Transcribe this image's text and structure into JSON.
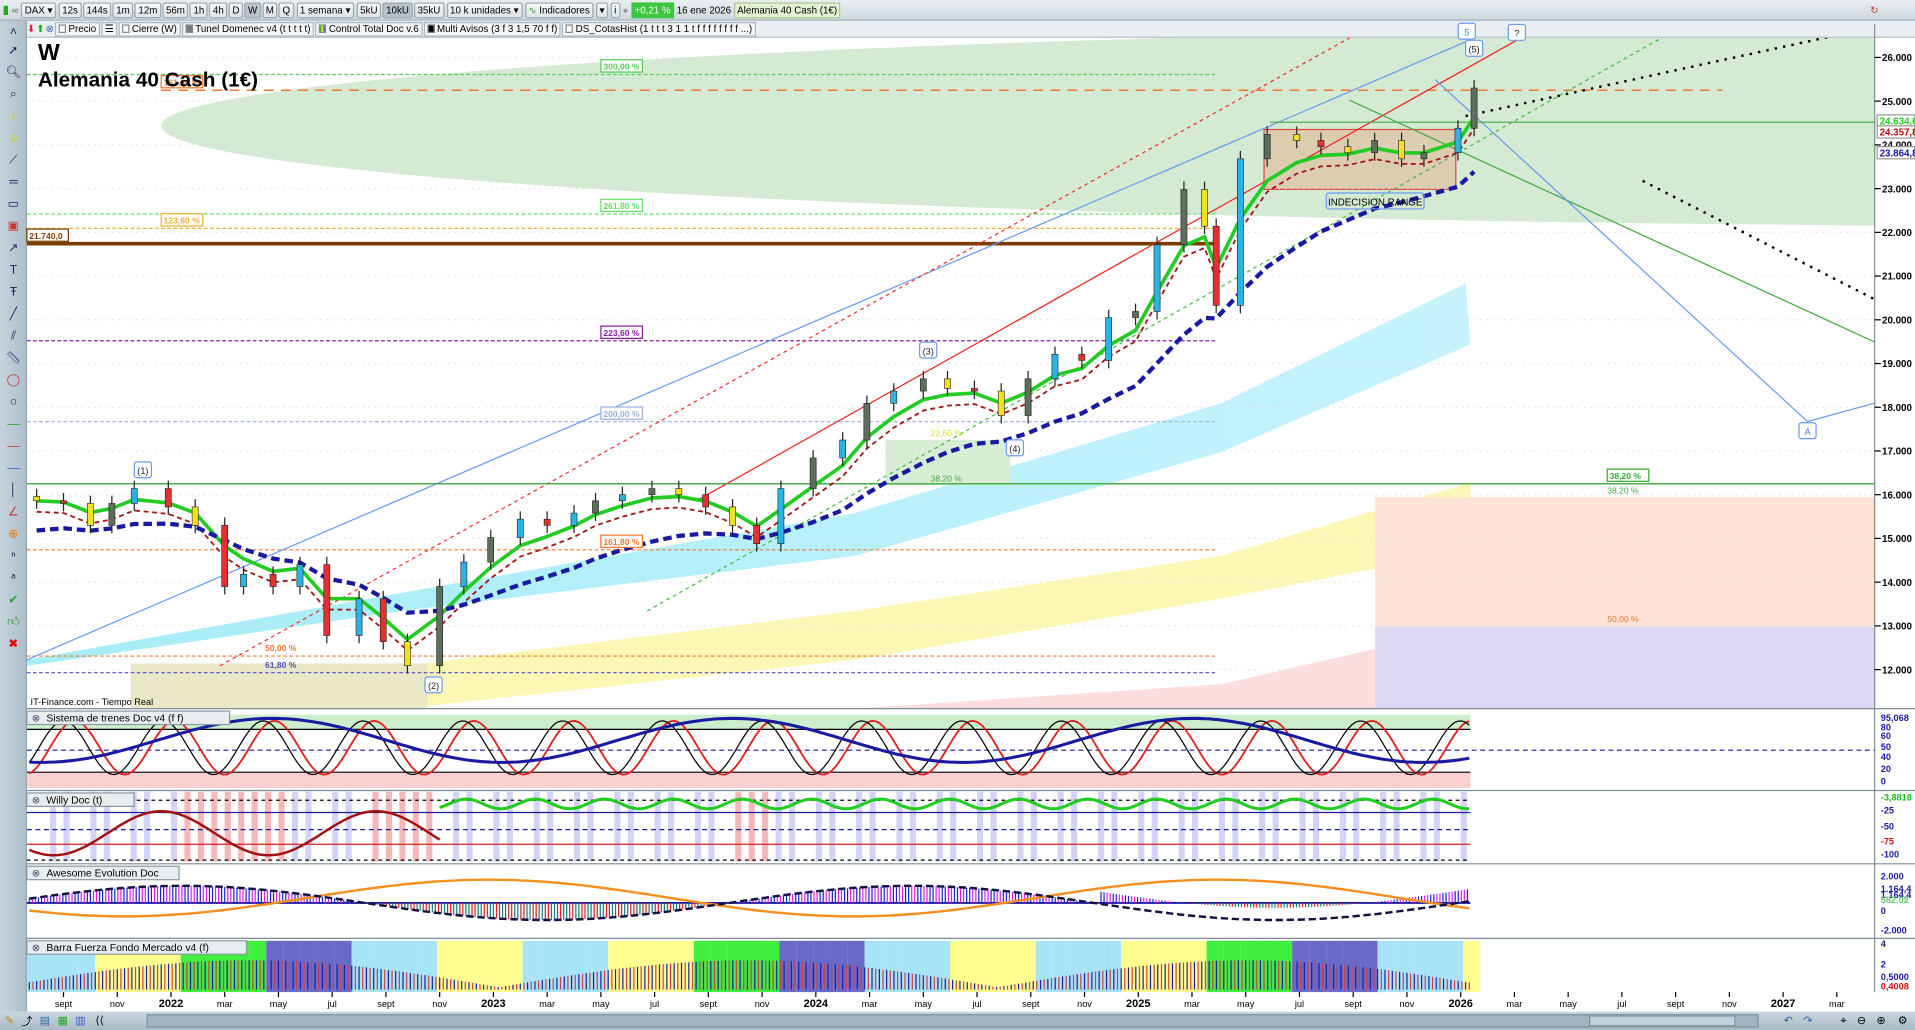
{
  "toolbar": {
    "symbol": "DAX",
    "intervals": [
      "12s",
      "144s",
      "1m",
      "12m",
      "56m",
      "1h",
      "4h",
      "D",
      "W",
      "M",
      "Q"
    ],
    "active_interval": "W",
    "period": "1 semana",
    "units": [
      "5kU",
      "10kU",
      "35kU"
    ],
    "active_unit": "10kU",
    "units_select": "10 k unidades",
    "indicators": "Indicadores",
    "info": "i",
    "change": "+0,21 %",
    "date": "16 ene 2026",
    "instrument": "Alemania 40 Cash (1€)"
  },
  "chips": [
    "Precio",
    "Cierre (W)",
    "Tunel Domenec v4 (t t t t t)",
    "Control Total Doc v.6",
    "Multi Avisos (3 f 3 1,5 70 f f)",
    "DS_CotasHist (1 t t t 3 1 1 t f f f f f f f f ...)"
  ],
  "main": {
    "timeframe": "W",
    "title": "Alemania 40 Cash (1€)",
    "source": "IT-Finance.com - Tiempo Real",
    "range_label": "INDECISION RANGE",
    "waves": [
      "(1)",
      "(2)",
      "(3)",
      "(4)",
      "(5)",
      "5",
      "?",
      "A"
    ],
    "price_badges": [
      {
        "text": "24.634,6",
        "color": "#22cc22"
      },
      {
        "text": "24.357,8",
        "color": "#b01010"
      },
      {
        "text": "23.864,8",
        "color": "#1a1aa0"
      }
    ]
  },
  "chart_data": {
    "type": "candlestick",
    "y_ticks": [
      "26.000",
      "25.000",
      "24.000",
      "23.000",
      "22.000",
      "21.000",
      "20.000",
      "19.000",
      "18.000",
      "17.000",
      "16.000",
      "15.000",
      "14.000",
      "13.000",
      "12.000"
    ],
    "x_ticks": [
      [
        "2021-09",
        "sept"
      ],
      [
        "2021-11",
        "nov"
      ],
      [
        "2022-01",
        "2022"
      ],
      [
        "2022-03",
        "mar"
      ],
      [
        "2022-05",
        "may"
      ],
      [
        "2022-07",
        "jul"
      ],
      [
        "2022-09",
        "sept"
      ],
      [
        "2022-11",
        "nov"
      ],
      [
        "2023-01",
        "2023"
      ],
      [
        "2023-03",
        "mar"
      ],
      [
        "2023-05",
        "may"
      ],
      [
        "2023-07",
        "jul"
      ],
      [
        "2023-09",
        "sept"
      ],
      [
        "2023-11",
        "nov"
      ],
      [
        "2024-01",
        "2024"
      ],
      [
        "2024-03",
        "mar"
      ],
      [
        "2024-05",
        "may"
      ],
      [
        "2024-07",
        "jul"
      ],
      [
        "2024-09",
        "sept"
      ],
      [
        "2024-11",
        "nov"
      ],
      [
        "2025-01",
        "2025"
      ],
      [
        "2025-03",
        "mar"
      ],
      [
        "2025-05",
        "may"
      ],
      [
        "2025-07",
        "jul"
      ],
      [
        "2025-09",
        "sept"
      ],
      [
        "2025-11",
        "nov"
      ],
      [
        "2026-01",
        "2026"
      ],
      [
        "2026-03",
        "mar"
      ],
      [
        "2026-05",
        "may"
      ],
      [
        "2026-07",
        "jul"
      ],
      [
        "2026-09",
        "sept"
      ],
      [
        "2026-11",
        "nov"
      ],
      [
        "2027-01",
        "2027"
      ],
      [
        "2027-03",
        "mar"
      ]
    ],
    "ylim": [
      12000,
      26000
    ],
    "prices": [
      [
        "2021-08-01",
        15860
      ],
      [
        "2021-09-01",
        15800
      ],
      [
        "2021-10-01",
        15300
      ],
      [
        "2021-10-25",
        15800
      ],
      [
        "2021-11-20",
        16140
      ],
      [
        "2021-12-28",
        15720
      ],
      [
        "2022-01-28",
        15300
      ],
      [
        "2022-03-01",
        13900
      ],
      [
        "2022-03-22",
        14180
      ],
      [
        "2022-04-25",
        13900
      ],
      [
        "2022-05-25",
        14400
      ],
      [
        "2022-06-25",
        12780
      ],
      [
        "2022-08-01",
        13620
      ],
      [
        "2022-08-28",
        12640
      ],
      [
        "2022-09-25",
        12090
      ],
      [
        "2022-11-01",
        13900
      ],
      [
        "2022-11-28",
        14460
      ],
      [
        "2022-12-28",
        15020
      ],
      [
        "2023-02-01",
        15440
      ],
      [
        "2023-03-01",
        15300
      ],
      [
        "2023-04-01",
        15580
      ],
      [
        "2023-04-25",
        15860
      ],
      [
        "2023-05-25",
        16000
      ],
      [
        "2023-06-28",
        16140
      ],
      [
        "2023-07-28",
        16000
      ],
      [
        "2023-08-28",
        15720
      ],
      [
        "2023-09-28",
        15300
      ],
      [
        "2023-10-25",
        14880
      ],
      [
        "2023-11-22",
        16140
      ],
      [
        "2023-12-28",
        16840
      ],
      [
        "2024-02-01",
        17250
      ],
      [
        "2024-02-28",
        18090
      ],
      [
        "2024-03-28",
        18370
      ],
      [
        "2024-05-01",
        18650
      ],
      [
        "2024-05-28",
        18430
      ],
      [
        "2024-06-28",
        18370
      ],
      [
        "2024-07-28",
        17810
      ],
      [
        "2024-08-28",
        18650
      ],
      [
        "2024-09-28",
        19210
      ],
      [
        "2024-10-28",
        19070
      ],
      [
        "2024-11-28",
        20050
      ],
      [
        "2024-12-28",
        20190
      ],
      [
        "2025-01-22",
        21720
      ],
      [
        "2025-02-22",
        22980
      ],
      [
        "2025-03-15",
        22140
      ],
      [
        "2025-03-28",
        20330
      ],
      [
        "2025-04-25",
        23680
      ],
      [
        "2025-05-25",
        24240
      ],
      [
        "2025-06-28",
        24100
      ],
      [
        "2025-07-25",
        23960
      ],
      [
        "2025-08-25",
        23820
      ],
      [
        "2025-09-25",
        24100
      ],
      [
        "2025-10-25",
        23680
      ],
      [
        "2025-11-20",
        23820
      ],
      [
        "2025-12-28",
        24380
      ],
      [
        "2026-01-16",
        25300
      ]
    ],
    "levels": [
      {
        "label": "300,00 %",
        "price": 25610,
        "color": "#55cc55"
      },
      {
        "label": "161,80 %",
        "price": 25250,
        "color": "#f07830"
      },
      {
        "label": "261,80 %",
        "price": 22420,
        "color": "#66dd66"
      },
      {
        "label": "123,60 %",
        "price": 22090,
        "color": "#f0b030"
      },
      {
        "label": "21.740,0",
        "price": 21740,
        "color": "#7a3c00"
      },
      {
        "label": "223,60 %",
        "price": 19520,
        "color": "#8a1aa0"
      },
      {
        "label": "200,00 %",
        "price": 17670,
        "color": "#9ab0e0"
      },
      {
        "label": "38,20 %",
        "price": 16250,
        "color": "#33aa33"
      },
      {
        "label": "161,80 %",
        "price": 14740,
        "color": "#f07830"
      },
      {
        "label": "50,00 %",
        "price": 12310,
        "color": "#f07830"
      },
      {
        "label": "61,80 %",
        "price": 11930,
        "color": "#5050c0"
      }
    ],
    "retracement_labels": [
      "23,60 %",
      "38,20 %",
      "38,20 %",
      "50,00 %"
    ]
  },
  "panes": [
    {
      "title": "Sistema de trenes Doc v4 (f f)",
      "axis": [
        "95,068",
        "80",
        "60",
        "50",
        "40",
        "20",
        "0"
      ]
    },
    {
      "title": "Willy Doc (t)",
      "axis": [
        "-3,8818",
        "-25",
        "-50",
        "-75",
        "-100"
      ]
    },
    {
      "title": "Awesome Evolution Doc",
      "axis": [
        "2.000",
        "1.164,4",
        "1.164,4",
        "582,02",
        "0",
        "-2.000"
      ]
    },
    {
      "title": "Barra Fuerza Fondo Mercado v4 (f)",
      "axis": [
        "4",
        "2",
        "0,5000",
        "0,4008"
      ]
    }
  ]
}
